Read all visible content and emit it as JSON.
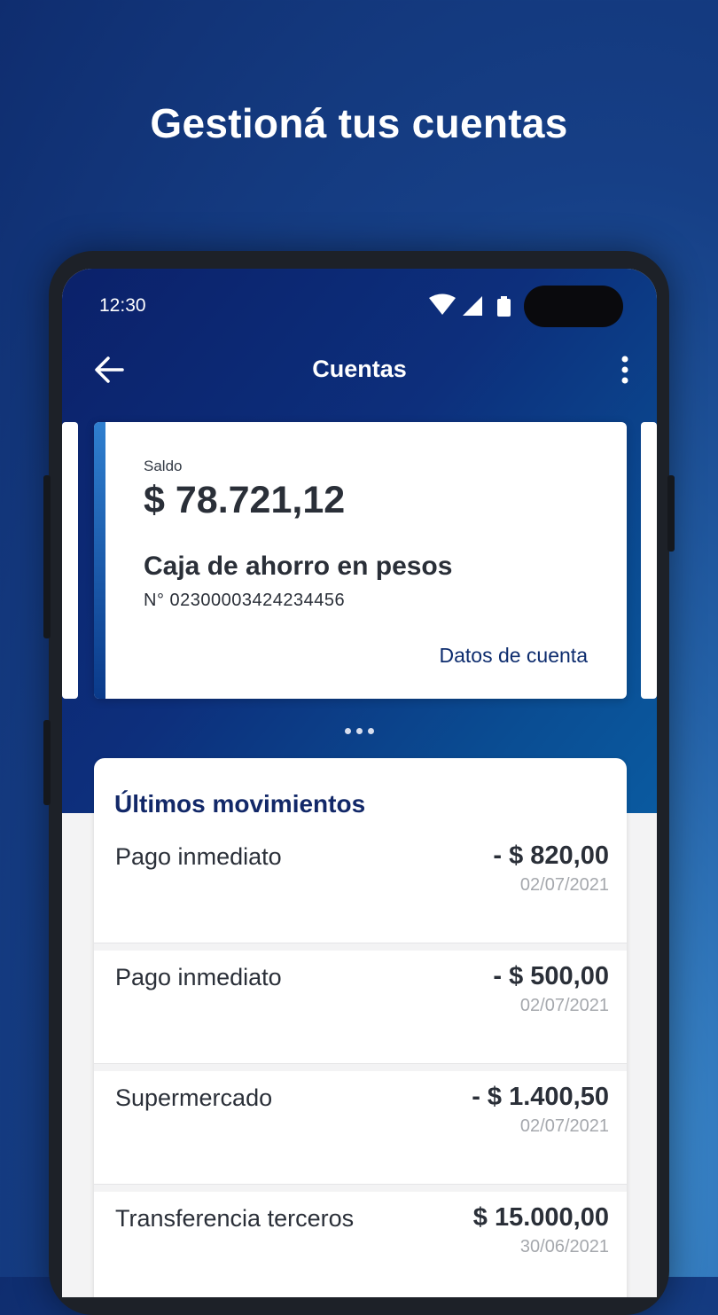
{
  "headline": "Gestioná tus cuentas",
  "status_bar": {
    "time": "12:30"
  },
  "app_bar": {
    "title": "Cuentas"
  },
  "account_card": {
    "balance_label": "Saldo",
    "balance": "$ 78.721,12",
    "account_type": "Caja de ahorro en pesos",
    "account_number": "N° 02300003424234456",
    "details_link": "Datos de cuenta"
  },
  "movements": {
    "title": "Últimos movimientos",
    "items": [
      {
        "description": "Pago inmediato",
        "amount": "- $ 820,00",
        "date": "02/07/2021"
      },
      {
        "description": "Pago inmediato",
        "amount": "- $ 500,00",
        "date": "02/07/2021"
      },
      {
        "description": "Supermercado",
        "amount": "- $ 1.400,50",
        "date": "02/07/2021"
      },
      {
        "description": "Transferencia terceros",
        "amount": "$ 15.000,00",
        "date": "30/06/2021"
      }
    ]
  },
  "icons": [
    "back-arrow-icon",
    "more-vertical-icon",
    "wifi-icon",
    "signal-icon",
    "battery-icon"
  ],
  "colors": {
    "brand_dark": "#0d2c6e",
    "title_blue": "#122868",
    "date_gray": "#a5a8ad"
  }
}
